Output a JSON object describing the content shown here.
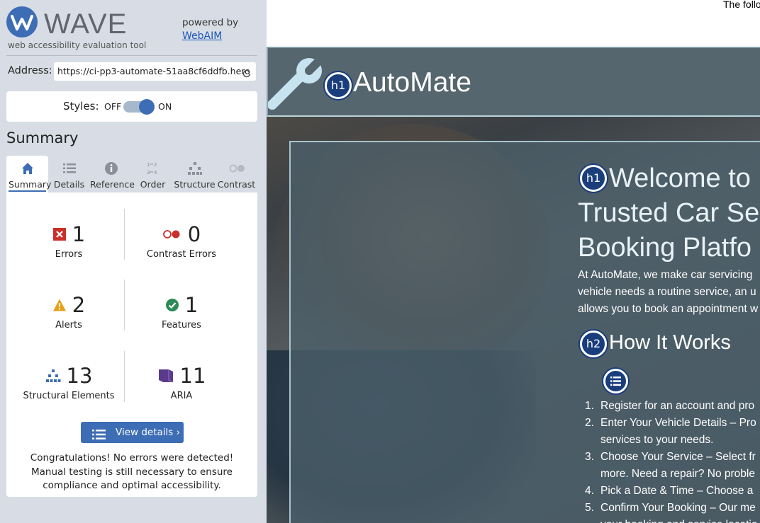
{
  "wave": {
    "logo_word": "WAVE",
    "tagline": "web accessibility evaluation tool",
    "powered_by": "powered by",
    "webaim_link": "WebAIM",
    "address_label": "Address:",
    "address_value": "https://ci-pp3-automate-51aa8cf6ddfb.hero",
    "styles_label": "Styles:",
    "styles_off": "OFF",
    "styles_on": "ON",
    "styles_state": "on",
    "summary_heading": "Summary",
    "tabs": [
      {
        "label": "Summary",
        "icon": "home-icon",
        "active": true
      },
      {
        "label": "Details",
        "icon": "list-icon"
      },
      {
        "label": "Reference",
        "icon": "info-icon"
      },
      {
        "label": "Order",
        "icon": "order-icon"
      },
      {
        "label": "Structure",
        "icon": "structure-icon"
      },
      {
        "label": "Contrast",
        "icon": "contrast-icon"
      }
    ],
    "stats": {
      "errors": {
        "count": "1",
        "label": "Errors",
        "icon": "error-icon",
        "color": "#c9302c"
      },
      "contrast_errors": {
        "count": "0",
        "label": "Contrast Errors",
        "icon": "contrast-error-icon",
        "color": "#c9302c"
      },
      "alerts": {
        "count": "2",
        "label": "Alerts",
        "icon": "alert-icon",
        "color": "#e6a117"
      },
      "features": {
        "count": "1",
        "label": "Features",
        "icon": "feature-icon",
        "color": "#2e8b57"
      },
      "structural": {
        "count": "13",
        "label": "Structural Elements",
        "icon": "structure-icon",
        "color": "#3d6db5"
      },
      "aria": {
        "count": "11",
        "label": "ARIA",
        "icon": "aria-icon",
        "color": "#5b3a8c"
      }
    },
    "view_details_label": "View details ›",
    "congrats_text": "Congratulations! No errors were detected! Manual testing is still necessary to ensure compliance and optimal accessibility."
  },
  "page": {
    "top_text": "The follo",
    "brand": "AutoMate",
    "h1_badge": "h1",
    "h2_badge": "h2",
    "hero_title_lines": [
      "Welcome to",
      "Trusted Car Se",
      "Booking Platfo"
    ],
    "hero_text_lines": [
      "At AutoMate, we make car servicing",
      "vehicle needs a routine service, an u",
      "allows you to book an appointment w"
    ],
    "how_title": "How It Works",
    "steps": [
      {
        "num": "1.",
        "text": "Register for an account and pro",
        "cont": ""
      },
      {
        "num": "2.",
        "text": "Enter Your Vehicle Details – Pro",
        "cont": "services to your needs."
      },
      {
        "num": "3.",
        "text": "Choose Your Service – Select fr",
        "cont": "more. Need a repair? No proble"
      },
      {
        "num": "4.",
        "text": "Pick a Date & Time – Choose a",
        "cont": ""
      },
      {
        "num": "5.",
        "text": "Confirm Your Booking – Our me",
        "cont": "your booking and service locatio"
      }
    ]
  },
  "colors": {
    "wave_blue": "#3d6db5",
    "sidebar_bg": "#d8dde5",
    "header_bg": "#56666f",
    "badge_blue": "#1a3d7c"
  }
}
